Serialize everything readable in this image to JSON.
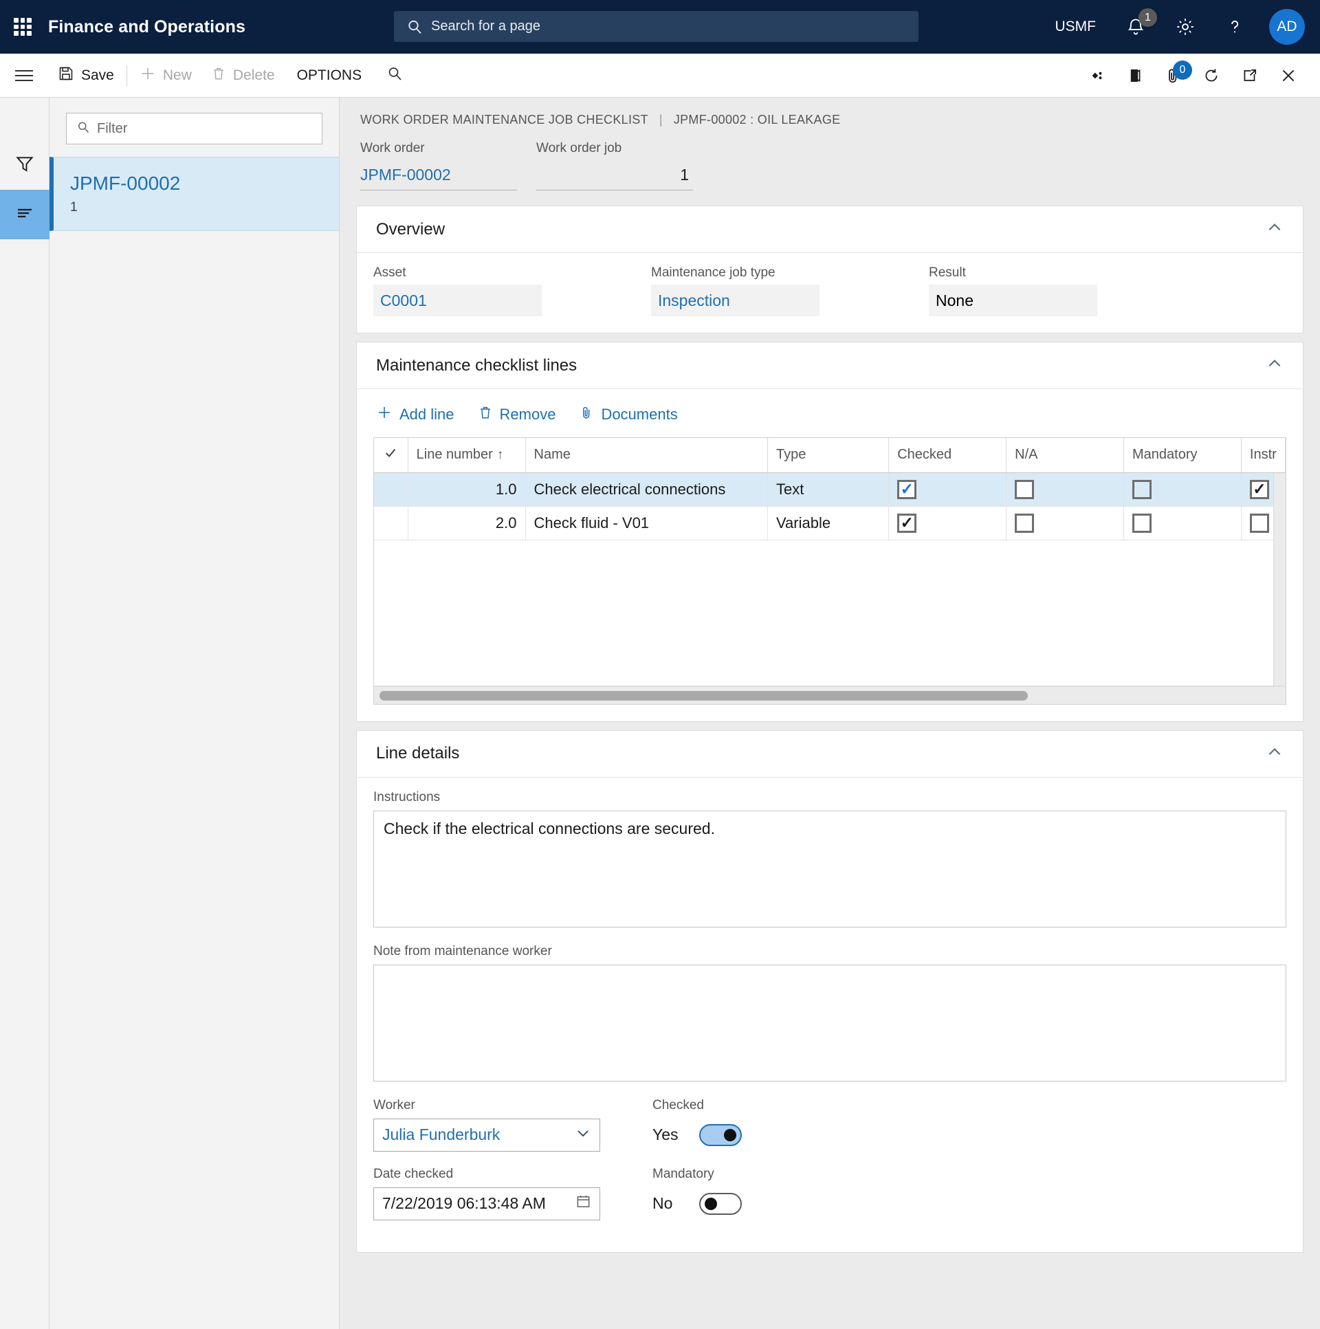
{
  "topbar": {
    "app_title": "Finance and Operations",
    "waffle_icon": "app-launcher-icon",
    "search_placeholder": "Search for a page",
    "search_icon": "search-icon",
    "company": "USMF",
    "notification_icon": "bell-icon",
    "notification_count": "1",
    "settings_icon": "gear-icon",
    "help_icon": "question-mark-icon",
    "avatar_initials": "AD"
  },
  "toolbar": {
    "hamburger_icon": "hamburger-menu-icon",
    "save_label": "Save",
    "save_icon": "save-disk-icon",
    "new_label": "New",
    "new_icon": "plus-icon",
    "delete_label": "Delete",
    "delete_icon": "trash-icon",
    "options_label": "OPTIONS",
    "find_icon": "search-icon",
    "flow_icon": "power-apps-icon",
    "office_icon": "office-icon",
    "attachment_icon": "paperclip-icon",
    "attachment_count": "0",
    "refresh_icon": "refresh-icon",
    "popout_icon": "open-in-new-window-icon",
    "close_icon": "close-x-icon"
  },
  "rail": {
    "filter_icon": "funnel-filter-icon",
    "list_icon": "list-lines-icon"
  },
  "listpanel": {
    "filter_placeholder": "Filter",
    "filter_icon": "search-icon",
    "items": [
      {
        "title": "JPMF-00002",
        "subtitle": "1"
      }
    ]
  },
  "breadcrumb": {
    "page": "WORK ORDER MAINTENANCE JOB CHECKLIST",
    "separator": "|",
    "record": "JPMF-00002 : OIL LEAKAGE"
  },
  "header_fields": [
    {
      "label": "Work order",
      "value": "JPMF-00002",
      "style": "link"
    },
    {
      "label": "Work order job",
      "value": "1",
      "style": "num"
    }
  ],
  "overview": {
    "title": "Overview",
    "collapse_icon": "chevron-up-icon",
    "fields": [
      {
        "label": "Asset",
        "value": "C0001",
        "style": "link"
      },
      {
        "label": "Maintenance job type",
        "value": "Inspection",
        "style": "link"
      },
      {
        "label": "Result",
        "value": "None",
        "style": "plain"
      }
    ]
  },
  "checklist": {
    "title": "Maintenance checklist lines",
    "collapse_icon": "chevron-up-icon",
    "toolbar": [
      {
        "label": "Add line",
        "icon": "plus-icon"
      },
      {
        "label": "Remove",
        "icon": "trash-icon"
      },
      {
        "label": "Documents",
        "icon": "paperclip-icon"
      }
    ],
    "columns": {
      "select": "",
      "line_number": "Line number",
      "sort_arrow": "↑",
      "name": "Name",
      "type": "Type",
      "checked": "Checked",
      "na": "N/A",
      "mandatory": "Mandatory",
      "instructions": "Instr"
    },
    "rows": [
      {
        "line_number": "1.0",
        "name": "Check electrical connections",
        "type": "Text",
        "checked": true,
        "na": false,
        "mandatory": false,
        "instructions": true,
        "selected": true
      },
      {
        "line_number": "2.0",
        "name": "Check fluid - V01",
        "type": "Variable",
        "checked": true,
        "na": false,
        "mandatory": false,
        "instructions": false,
        "selected": false
      }
    ]
  },
  "line_details": {
    "title": "Line details",
    "collapse_icon": "chevron-up-icon",
    "instructions_label": "Instructions",
    "instructions_value": "Check if the electrical connections are secured.",
    "note_label": "Note from maintenance worker",
    "note_value": "",
    "worker_label": "Worker",
    "worker_value": "Julia Funderburk",
    "worker_dropdown_icon": "chevron-down-icon",
    "date_label": "Date checked",
    "date_value": "7/22/2019 06:13:48 AM",
    "date_icon": "calendar-icon",
    "checked_label": "Checked",
    "checked_state": "Yes",
    "mandatory_label": "Mandatory",
    "mandatory_state": "No"
  },
  "colors": {
    "nav_bg": "#0b1f3f",
    "accent_blue": "#1f6fb2",
    "link_blue": "#1774d1",
    "selection_blue": "#d9eaf7",
    "page_bg": "#ebebeb"
  }
}
